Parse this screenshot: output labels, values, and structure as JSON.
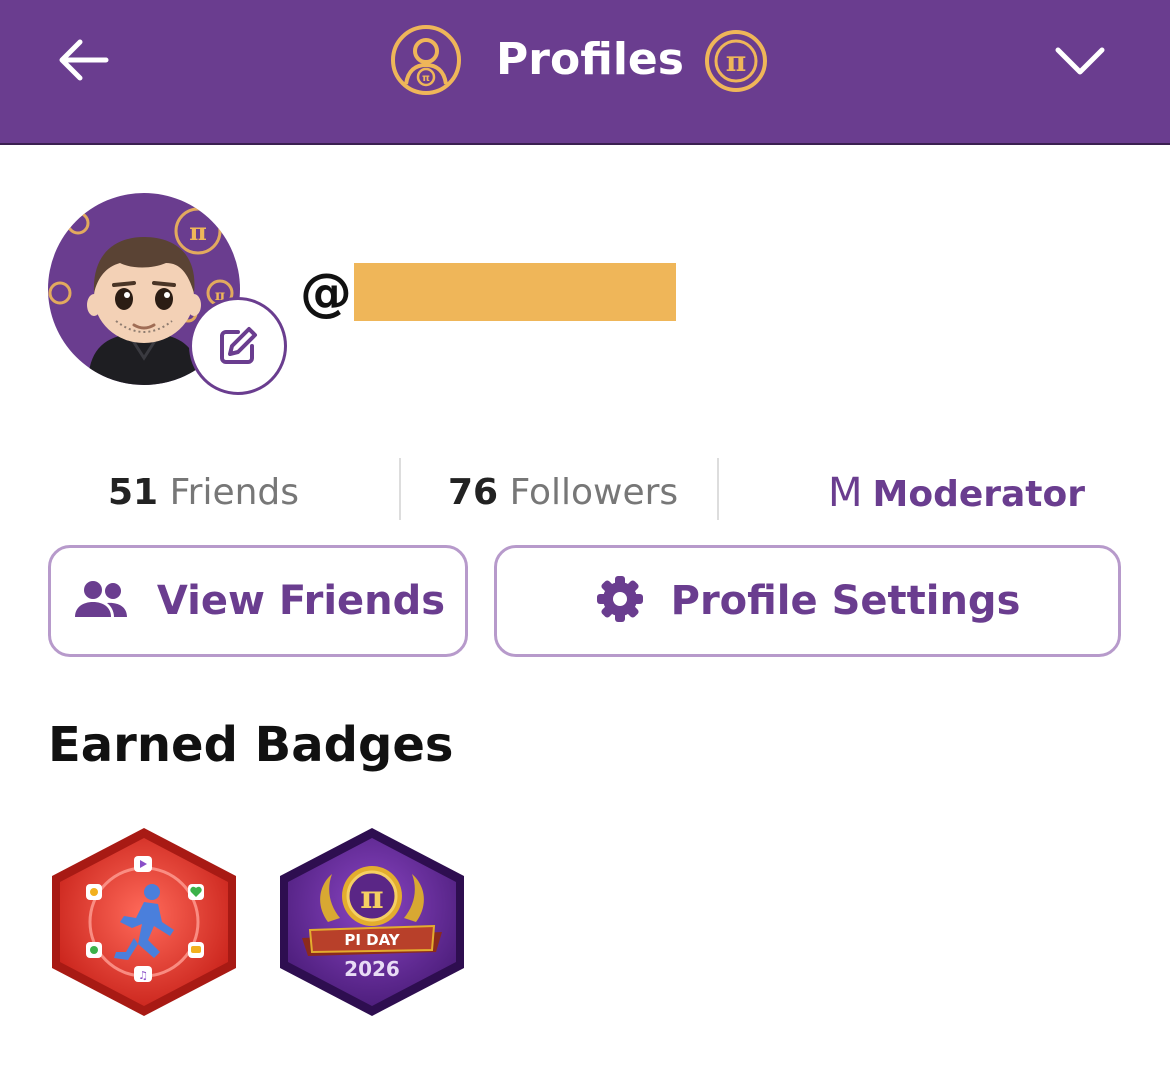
{
  "header": {
    "title": "Profiles",
    "background_color": "#6a3d8f",
    "accent_color": "#efb659",
    "left_icon": "back-arrow-icon",
    "right_icon": "chevron-down-icon",
    "title_icons": [
      "profile-circle-icon",
      "pi-coin-icon"
    ]
  },
  "profile": {
    "username_prefix": "@",
    "username_redacted_color": "#efb659",
    "avatar_icon": "avatar-image",
    "edit_icon": "edit-pencil-icon"
  },
  "stats": {
    "friends_count": "51",
    "friends_label": "Friends",
    "followers_count": "76",
    "followers_label": "Followers",
    "role_initial": "M",
    "role_label": "Moderator"
  },
  "actions": {
    "view_friends_label": "View Friends",
    "view_friends_icon": "people-icon",
    "profile_settings_label": "Profile Settings",
    "profile_settings_icon": "gear-icon"
  },
  "badges": {
    "section_title": "Earned Badges",
    "items": [
      {
        "icon": "running-activity-badge"
      },
      {
        "icon": "pi-day-badge",
        "banner_text": "PI DAY",
        "year_text": "2026"
      }
    ]
  }
}
